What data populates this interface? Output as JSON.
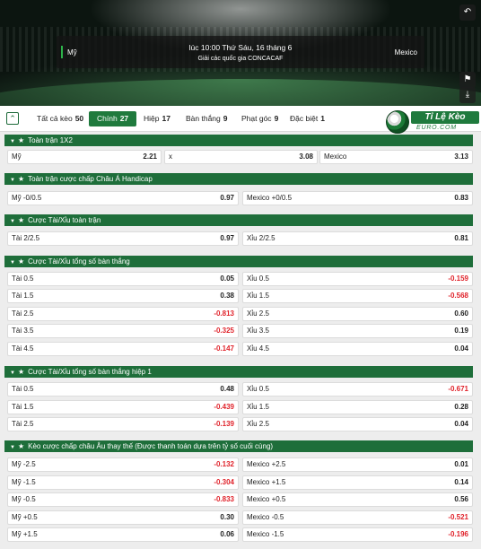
{
  "header": {
    "home_team": "Mỹ",
    "away_team": "Mexico",
    "kickoff": "lúc 10:00 Thứ Sáu, 16 tháng 6",
    "league": "Giải các quốc gia CONCACAF",
    "buttons": {
      "back": "↶",
      "pin": "⚑",
      "download": "⤓"
    }
  },
  "tabs": [
    {
      "label": "Tất cả kèo",
      "count": "50"
    },
    {
      "label": "Chính",
      "count": "27"
    },
    {
      "label": "Hiệp",
      "count": "17"
    },
    {
      "label": "Bàn thắng",
      "count": "9"
    },
    {
      "label": "Phạt góc",
      "count": "9"
    },
    {
      "label": "Đặc biệt",
      "count": "1"
    }
  ],
  "logo": {
    "title": "Tỉ Lệ Kèo",
    "subtitle": "EURO.COM"
  },
  "sections": [
    {
      "title": "Toàn trận 1X2",
      "rows": [
        [
          {
            "label": "Mỹ",
            "value": "2.21"
          },
          {
            "label": "x",
            "value": "3.08"
          },
          {
            "label": "Mexico",
            "value": "3.13"
          }
        ]
      ]
    },
    {
      "title": "Toàn trận cược chấp Châu Á Handicap",
      "rows": [
        [
          {
            "label": "Mỹ -0/0.5",
            "value": "0.97"
          },
          {
            "label": "Mexico +0/0.5",
            "value": "0.83"
          }
        ]
      ]
    },
    {
      "title": "Cược Tài/Xỉu toàn trận",
      "rows": [
        [
          {
            "label": "Tài 2/2.5",
            "value": "0.97"
          },
          {
            "label": "Xỉu 2/2.5",
            "value": "0.81"
          }
        ]
      ]
    },
    {
      "title": "Cược Tài/Xỉu tổng số bàn thắng",
      "rows": [
        [
          {
            "label": "Tài 0.5",
            "value": "0.05"
          },
          {
            "label": "Xỉu 0.5",
            "value": "-0.159"
          }
        ],
        [
          {
            "label": "Tài 1.5",
            "value": "0.38"
          },
          {
            "label": "Xỉu 1.5",
            "value": "-0.568"
          }
        ],
        [
          {
            "label": "Tài 2.5",
            "value": "-0.813"
          },
          {
            "label": "Xỉu 2.5",
            "value": "0.60"
          }
        ],
        [
          {
            "label": "Tài 3.5",
            "value": "-0.325"
          },
          {
            "label": "Xỉu 3.5",
            "value": "0.19"
          }
        ],
        [
          {
            "label": "Tài 4.5",
            "value": "-0.147"
          },
          {
            "label": "Xỉu 4.5",
            "value": "0.04"
          }
        ]
      ]
    },
    {
      "title": "Cược Tài/Xỉu tổng số bàn thắng hiệp 1",
      "rows": [
        [
          {
            "label": "Tài 0.5",
            "value": "0.48"
          },
          {
            "label": "Xỉu 0.5",
            "value": "-0.671"
          }
        ],
        [
          {
            "label": "Tài 1.5",
            "value": "-0.439"
          },
          {
            "label": "Xỉu 1.5",
            "value": "0.28"
          }
        ],
        [
          {
            "label": "Tài 2.5",
            "value": "-0.139"
          },
          {
            "label": "Xỉu 2.5",
            "value": "0.04"
          }
        ]
      ]
    },
    {
      "title": "Kèo cược chấp châu Âu thay thế (Được thanh toán dựa trên tỷ số cuối cùng)",
      "rows": [
        [
          {
            "label": "Mỹ -2.5",
            "value": "-0.132"
          },
          {
            "label": "Mexico +2.5",
            "value": "0.01"
          }
        ],
        [
          {
            "label": "Mỹ -1.5",
            "value": "-0.304"
          },
          {
            "label": "Mexico +1.5",
            "value": "0.14"
          }
        ],
        [
          {
            "label": "Mỹ -0.5",
            "value": "-0.833"
          },
          {
            "label": "Mexico +0.5",
            "value": "0.56"
          }
        ],
        [
          {
            "label": "Mỹ +0.5",
            "value": "0.30"
          },
          {
            "label": "Mexico -0.5",
            "value": "-0.521"
          }
        ],
        [
          {
            "label": "Mỹ +1.5",
            "value": "0.06"
          },
          {
            "label": "Mexico -1.5",
            "value": "-0.196"
          }
        ]
      ]
    }
  ]
}
